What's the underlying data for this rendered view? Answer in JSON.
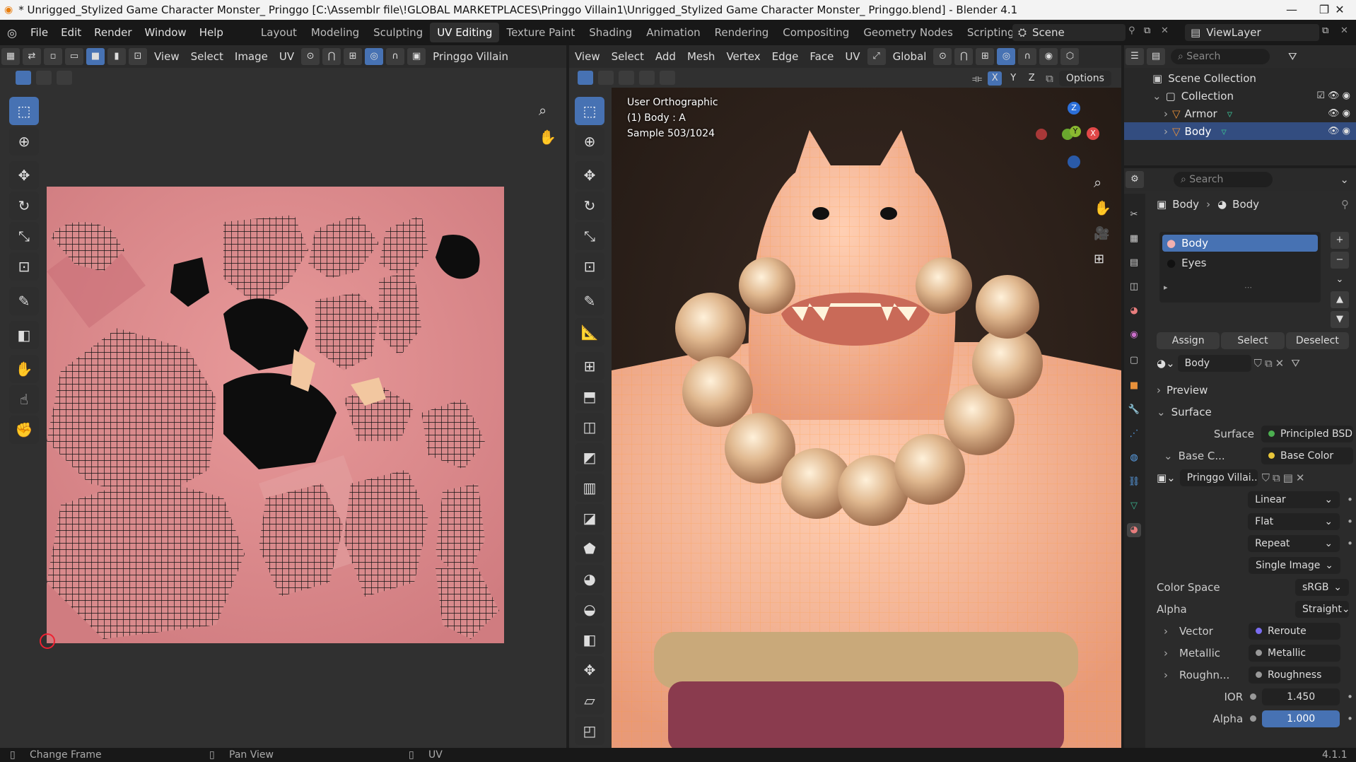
{
  "window": {
    "title": "* Unrigged_Stylized Game Character Monster_ Pringgo [C:\\Assemblr file\\!GLOBAL MARKETPLACES\\Pringgo Villain1\\Unrigged_Stylized Game Character Monster_ Pringgo.blend] - Blender 4.1",
    "minimize": "—",
    "maximize": "❐",
    "close": "✕"
  },
  "menu": [
    "File",
    "Edit",
    "Render",
    "Window",
    "Help"
  ],
  "workspaces": [
    "Layout",
    "Modeling",
    "Sculpting",
    "UV Editing",
    "Texture Paint",
    "Shading",
    "Animation",
    "Rendering",
    "Compositing",
    "Geometry Nodes",
    "Scripting",
    "+"
  ],
  "active_workspace": "UV Editing",
  "scene": {
    "label": "Scene",
    "viewlayer": "ViewLayer"
  },
  "uv_editor": {
    "menus": [
      "View",
      "Select",
      "Image",
      "UV"
    ],
    "image_name": "Pringgo Villain"
  },
  "viewport": {
    "menus": [
      "View",
      "Select",
      "Add",
      "Mesh",
      "Vertex",
      "Edge",
      "Face",
      "UV"
    ],
    "orientation": "Global",
    "axes": [
      "X",
      "Y",
      "Z"
    ],
    "options": "Options",
    "overlay_line1": "User Orthographic",
    "overlay_line2": "(1) Body : A",
    "overlay_line3": "Sample 503/1024",
    "gizmo": {
      "z": "Z",
      "y": "Y",
      "x": "X"
    }
  },
  "outliner": {
    "search_placeholder": "Search",
    "scene_collection": "Scene Collection",
    "collection": "Collection",
    "items": [
      "Armor",
      "Body"
    ]
  },
  "properties": {
    "search_placeholder": "Search",
    "breadcrumb_object": "Body",
    "breadcrumb_material": "Body",
    "slots": [
      "Body",
      "Eyes"
    ],
    "assign": "Assign",
    "select": "Select",
    "deselect": "Deselect",
    "material_name": "Body",
    "preview": "Preview",
    "surface_section": "Surface",
    "surface_label": "Surface",
    "surface_value": "Principled BSDF",
    "base_color_label": "Base C...",
    "base_color_value": "Base Color",
    "image_name": "Pringgo Villai...",
    "interp": "Linear",
    "projection": "Flat",
    "extension": "Repeat",
    "source": "Single Image",
    "color_space_label": "Color Space",
    "color_space_value": "sRGB",
    "alpha_label": "Alpha",
    "alpha_value": "Straight",
    "vector_label": "Vector",
    "vector_value": "Reroute",
    "metallic_label": "Metallic",
    "metallic_value": "Metallic",
    "roughness_label": "Roughn...",
    "roughness_value": "Roughness",
    "ior_label": "IOR",
    "ior_value": "1.450",
    "alpha2_label": "Alpha",
    "alpha2_value": "1.000"
  },
  "status": {
    "left": "Change Frame",
    "mid": "Pan View",
    "right": "UV",
    "version": "4.1.1"
  },
  "colors": {
    "accent": "#4772b3",
    "uv_bg": "#d9868a",
    "skin": "#f0b69a",
    "wire": "#ff9a3c"
  }
}
